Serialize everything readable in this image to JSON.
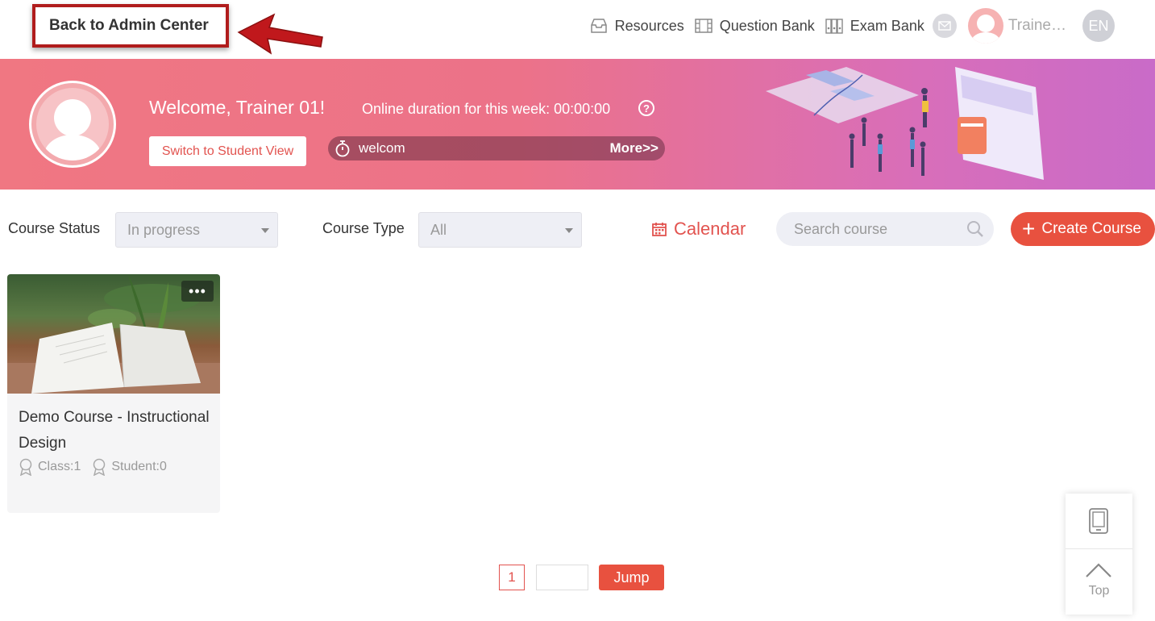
{
  "header": {
    "back_label": "Back to Admin Center",
    "nav": [
      {
        "label": "Resources",
        "icon": "inbox-icon"
      },
      {
        "label": "Question Bank",
        "icon": "film-icon"
      },
      {
        "label": "Exam Bank",
        "icon": "binders-icon"
      }
    ],
    "user_name": "Traine…",
    "language": "EN"
  },
  "banner": {
    "welcome": "Welcome, Trainer 01!",
    "duration": "Online duration for this week: 00:00:00",
    "help": "?",
    "switch_label": "Switch to Student View",
    "notice_text": "welcom",
    "notice_more": "More>>"
  },
  "filters": {
    "status_label": "Course Status",
    "status_value": "In progress",
    "type_label": "Course Type",
    "type_value": "All",
    "calendar_label": "Calendar",
    "search_placeholder": "Search course",
    "create_label": "Create Course"
  },
  "courses": [
    {
      "title": "Demo Course - Instructional Design",
      "class_text": "Class:1",
      "student_text": "Student:0",
      "menu": "•••"
    }
  ],
  "pagination": {
    "current": "1",
    "jump_label": "Jump"
  },
  "floater": {
    "top_label": "Top"
  },
  "colors": {
    "accent": "#e8513f",
    "annotation_red": "#b01c1c"
  }
}
